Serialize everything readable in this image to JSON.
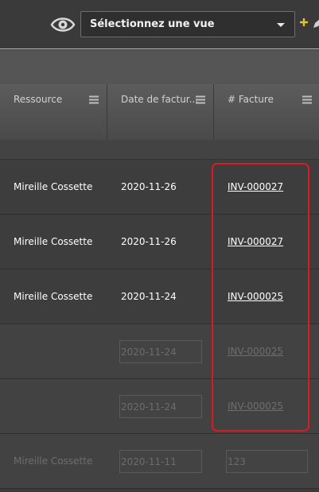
{
  "toolbar": {
    "view_select": {
      "label": "Sélectionnez une vue"
    },
    "icons": [
      "eye-icon",
      "plus-icon",
      "pencil-icon",
      "caret-down-icon"
    ],
    "accent_color": "#e3c32a"
  },
  "columns": [
    {
      "label": "Ressource"
    },
    {
      "label": "Date de factur..."
    },
    {
      "label": "# Facture"
    }
  ],
  "rows": [
    {
      "resource": "Mireille Cossette",
      "date": "2020-11-26",
      "invoice": "INV-000027",
      "state": "active"
    },
    {
      "resource": "Mireille Cossette",
      "date": "2020-11-26",
      "invoice": "INV-000027",
      "state": "active"
    },
    {
      "resource": "Mireille Cossette",
      "date": "2020-11-24",
      "invoice": "INV-000025",
      "state": "active"
    },
    {
      "resource": "",
      "date": "2020-11-24",
      "invoice": "INV-000025",
      "state": "dim"
    },
    {
      "resource": "",
      "date": "2020-11-24",
      "invoice": "INV-000025",
      "state": "dim"
    },
    {
      "resource": "Mireille Cossette",
      "date": "2020-11-11",
      "invoice": "123",
      "state": "dim"
    }
  ],
  "highlight_color": "#e0191f"
}
